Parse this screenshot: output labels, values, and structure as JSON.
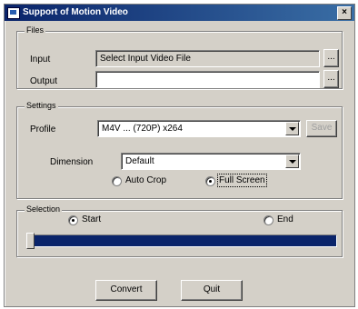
{
  "window": {
    "title": "Support of Motion Video",
    "close_label": "×"
  },
  "files": {
    "legend": "Files",
    "input_label": "Input",
    "input_value": "Select Input Video File",
    "input_browse": "...",
    "output_label": "Output",
    "output_value": "",
    "output_browse": "..."
  },
  "settings": {
    "legend": "Settings",
    "profile_label": "Profile",
    "profile_value": "M4V ... (720P) x264",
    "profile_button": "Save",
    "dimension_label": "Dimension",
    "dimension_value": "Default",
    "radio_auto": "Auto Crop",
    "radio_full": "Full Screen",
    "radio_auto_selected": false,
    "radio_full_selected": true
  },
  "selection": {
    "legend": "Selection",
    "start_label": "Start",
    "end_label": "End",
    "start_selected": true,
    "end_selected": false,
    "position": 0.0
  },
  "actions": {
    "convert_label": "Convert",
    "quit_label": "Quit"
  },
  "colors": {
    "title_start": "#0a246a",
    "title_end": "#3a6ea5",
    "face": "#d4d0c8",
    "track": "#0a246a"
  }
}
